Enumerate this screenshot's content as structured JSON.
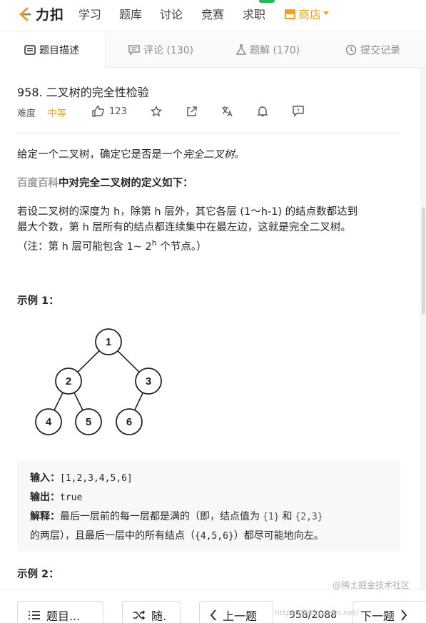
{
  "nav": {
    "logo_text": "力扣",
    "items": [
      "学习",
      "题库",
      "讨论",
      "竞赛",
      "求职"
    ],
    "shop_label": "商店"
  },
  "tabs": [
    {
      "label": "题目描述"
    },
    {
      "label": "评论 (130)"
    },
    {
      "label": "题解 (170)"
    },
    {
      "label": "提交记录"
    }
  ],
  "problem": {
    "title": "958. 二叉树的完全性检验",
    "difficulty_label": "难度",
    "difficulty": "中等",
    "likes": "123"
  },
  "description": {
    "intro_a": "给定一个二叉树，确定它是否是一个",
    "intro_b": "完全二叉树",
    "intro_c": "。",
    "def_link": "百度百科",
    "def_text": "中对完全二叉树的定义如下：",
    "para_line1": "若设二叉树的深度为 h，除第 h 层外，其它各层 (1～h-1) 的结点数都达到",
    "para_line2": "最大个数，第 h 层所有的结点都连续集中在最左边，这就是完全二叉树。",
    "para_line3_a": "（注：第 h 层可能包含 1~ 2",
    "para_line3_sup": "h",
    "para_line3_b": " 个节点。）"
  },
  "example1": {
    "heading": "示例 1：",
    "tree_nodes": [
      "1",
      "2",
      "3",
      "4",
      "5",
      "6"
    ],
    "input_label": "输入：",
    "input_value": "[1,2,3,4,5,6]",
    "output_label": "输出：",
    "output_value": "true",
    "explain_label": "解释：",
    "explain_a": "最后一层前的每一层都是满的（即，结点值为",
    "code1": "{1}",
    "explain_and": "和",
    "code2": "{2,3}",
    "explain_b": "的两层），且最后一层中的所有结点（",
    "code3": "{4,5,6}",
    "explain_c": "）都尽可能地向左。"
  },
  "example2": {
    "heading": "示例 2："
  },
  "bottom": {
    "list_label": "题目...",
    "random_label": "随.",
    "prev_label": "上一题",
    "pager": "958/2088",
    "next_label": "下一题"
  },
  "watermark": "@稀土掘金技术社区",
  "watermark_url": "https://blog.csdn.net/",
  "colors": {
    "accent_orange": "#f0a020",
    "green_badge": "#2db55d"
  }
}
